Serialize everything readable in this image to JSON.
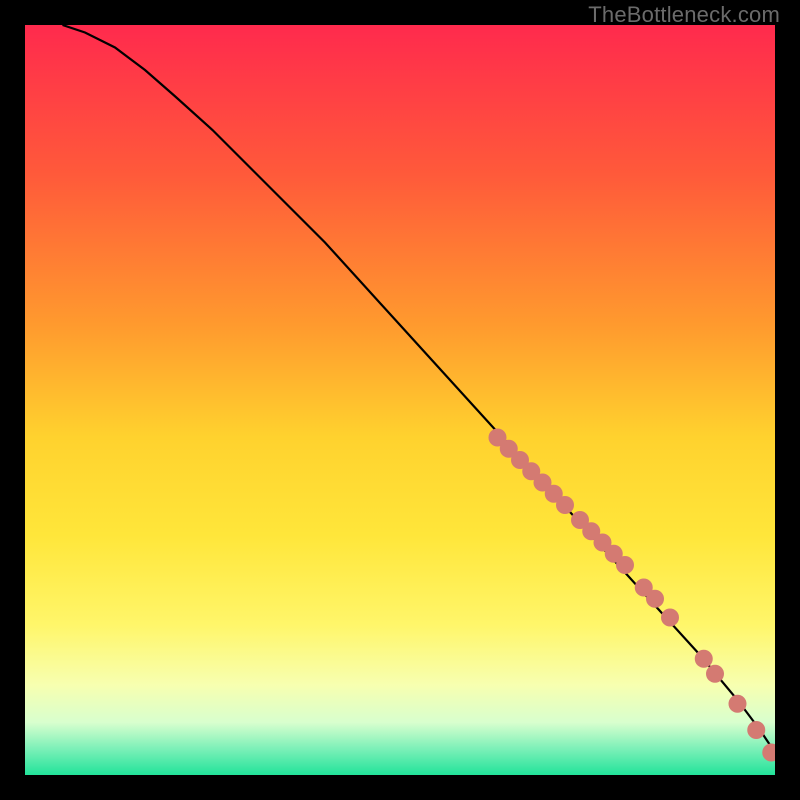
{
  "watermark": "TheBottleneck.com",
  "colors": {
    "bg": "#000000",
    "curve": "#000000",
    "marker_fill": "#d47a72",
    "marker_stroke": "#c86a62"
  },
  "chart_data": {
    "type": "line",
    "title": "",
    "xlabel": "",
    "ylabel": "",
    "xlim": [
      0,
      100
    ],
    "ylim": [
      0,
      100
    ],
    "gradient_stops": [
      {
        "offset": 0.0,
        "color": "#ff2a4d"
      },
      {
        "offset": 0.2,
        "color": "#ff5a3a"
      },
      {
        "offset": 0.4,
        "color": "#ff9a2e"
      },
      {
        "offset": 0.55,
        "color": "#ffd22e"
      },
      {
        "offset": 0.68,
        "color": "#ffe63a"
      },
      {
        "offset": 0.8,
        "color": "#fff66a"
      },
      {
        "offset": 0.88,
        "color": "#f7ffb0"
      },
      {
        "offset": 0.93,
        "color": "#d8ffce"
      },
      {
        "offset": 0.965,
        "color": "#7cf0b8"
      },
      {
        "offset": 1.0,
        "color": "#22e39a"
      }
    ],
    "series": [
      {
        "name": "curve",
        "x": [
          5,
          8,
          12,
          16,
          20,
          25,
          30,
          35,
          40,
          45,
          50,
          55,
          60,
          65,
          70,
          75,
          80,
          85,
          90,
          95,
          98,
          100
        ],
        "y": [
          100,
          99,
          97,
          94,
          90.5,
          86,
          81,
          76,
          71,
          65.5,
          60,
          54.5,
          49,
          43.5,
          38,
          32.5,
          27,
          21.5,
          16,
          10,
          6,
          3
        ]
      }
    ],
    "markers": [
      {
        "x": 63.0,
        "y": 45.0
      },
      {
        "x": 64.5,
        "y": 43.5
      },
      {
        "x": 66.0,
        "y": 42.0
      },
      {
        "x": 67.5,
        "y": 40.5
      },
      {
        "x": 69.0,
        "y": 39.0
      },
      {
        "x": 70.5,
        "y": 37.5
      },
      {
        "x": 72.0,
        "y": 36.0
      },
      {
        "x": 74.0,
        "y": 34.0
      },
      {
        "x": 75.5,
        "y": 32.5
      },
      {
        "x": 77.0,
        "y": 31.0
      },
      {
        "x": 78.5,
        "y": 29.5
      },
      {
        "x": 80.0,
        "y": 28.0
      },
      {
        "x": 82.5,
        "y": 25.0
      },
      {
        "x": 84.0,
        "y": 23.5
      },
      {
        "x": 86.0,
        "y": 21.0
      },
      {
        "x": 90.5,
        "y": 15.5
      },
      {
        "x": 92.0,
        "y": 13.5
      },
      {
        "x": 95.0,
        "y": 9.5
      },
      {
        "x": 97.5,
        "y": 6.0
      },
      {
        "x": 99.5,
        "y": 3.0
      },
      {
        "x": 100.8,
        "y": 2.8
      }
    ],
    "marker_radius": 9
  }
}
